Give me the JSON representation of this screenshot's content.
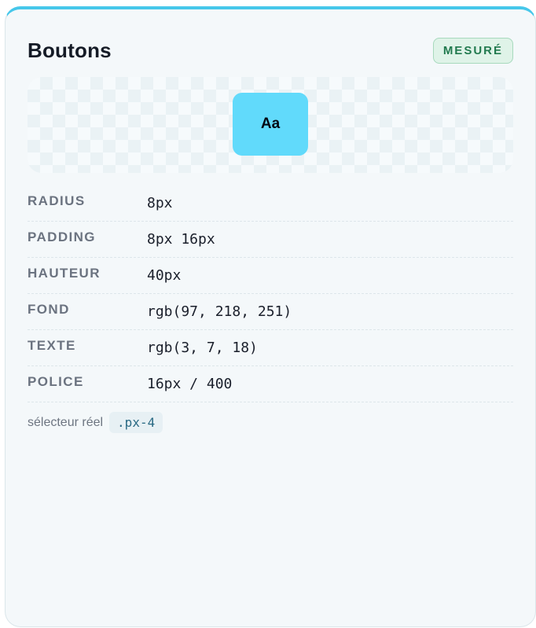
{
  "card": {
    "title": "Boutons",
    "badge": "MESURÉ"
  },
  "preview": {
    "button_label": "Aa"
  },
  "properties": [
    {
      "key": "RADIUS",
      "value": "8px"
    },
    {
      "key": "PADDING",
      "value": "8px 16px"
    },
    {
      "key": "HAUTEUR",
      "value": "40px"
    },
    {
      "key": "FOND",
      "value": "rgb(97, 218, 251)"
    },
    {
      "key": "TEXTE",
      "value": "rgb(3, 7, 18)"
    },
    {
      "key": "POLICE",
      "value": "16px / 400"
    }
  ],
  "selector": {
    "label": "sélecteur réel",
    "code": ".px-4"
  },
  "colors": {
    "accent": "#46c7ea",
    "button_background": "#61dafb",
    "button_text": "#030712",
    "badge_text": "#227a4f",
    "badge_background": "#dff3e8"
  }
}
